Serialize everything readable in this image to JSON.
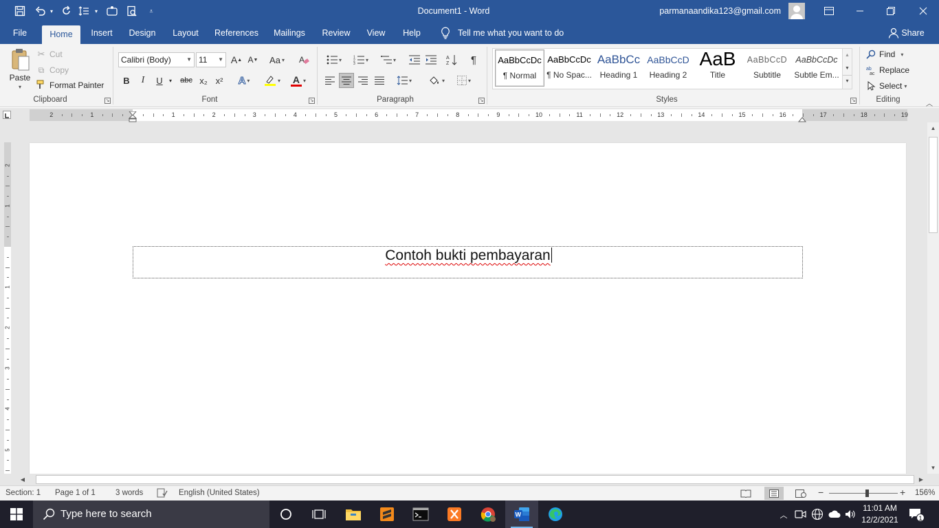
{
  "window": {
    "title": "Document1  -  Word",
    "account": "parmanaandika123@gmail.com"
  },
  "ribbon_tabs": [
    "File",
    "Home",
    "Insert",
    "Design",
    "Layout",
    "References",
    "Mailings",
    "Review",
    "View",
    "Help"
  ],
  "tell_me": "Tell me what you want to do",
  "share_label": "Share",
  "clipboard": {
    "paste": "Paste",
    "cut": "Cut",
    "copy": "Copy",
    "format_painter": "Format Painter",
    "label": "Clipboard"
  },
  "font": {
    "name": "Calibri (Body)",
    "size": "11",
    "label": "Font",
    "grow": "A",
    "shrink": "A",
    "case": "Aa",
    "bold": "B",
    "italic": "I",
    "underline": "U",
    "strike": "abc",
    "subscript": "x₂",
    "superscript": "x²",
    "effects": "A",
    "color": "A"
  },
  "paragraph": {
    "label": "Paragraph",
    "pilcrow": "¶"
  },
  "styles": {
    "label": "Styles",
    "items": [
      {
        "preview": "AaBbCcDc",
        "name": "¶ Normal"
      },
      {
        "preview": "AaBbCcDc",
        "name": "¶ No Spac..."
      },
      {
        "preview": "AaBbCc",
        "name": "Heading 1"
      },
      {
        "preview": "AaBbCcD",
        "name": "Heading 2"
      },
      {
        "preview": "AaB",
        "name": "Title"
      },
      {
        "preview": "AaBbCcD",
        "name": "Subtitle"
      },
      {
        "preview": "AaBbCcDc",
        "name": "Subtle Em..."
      }
    ]
  },
  "editing": {
    "label": "Editing",
    "find": "Find",
    "replace": "Replace",
    "select": "Select"
  },
  "ruler": {
    "numbers": [
      "2",
      "1",
      "1",
      "2",
      "3",
      "4",
      "5",
      "6",
      "7",
      "8",
      "9",
      "10",
      "11",
      "12",
      "13",
      "14",
      "15",
      "16",
      "17",
      "18",
      "19"
    ],
    "vertical_numbers": [
      "2",
      "1",
      "1",
      "2",
      "3",
      "4",
      "5"
    ]
  },
  "document": {
    "text": "Contoh bukti pembayaran"
  },
  "status": {
    "section": "Section: 1",
    "page": "Page 1 of 1",
    "words": "3 words",
    "language": "English (United States)",
    "zoom": "156%",
    "zoom_minus": "−",
    "zoom_plus": "+"
  },
  "taskbar": {
    "search_placeholder": "Type here to search",
    "time": "11:01 AM",
    "date": "12/2/2021",
    "notification_count": "1"
  },
  "colors": {
    "word_blue": "#2b579a",
    "ribbon_bg": "#f3f3f3",
    "taskbar_bg": "#1f1f2b",
    "heading_blue": "#2f5496"
  }
}
